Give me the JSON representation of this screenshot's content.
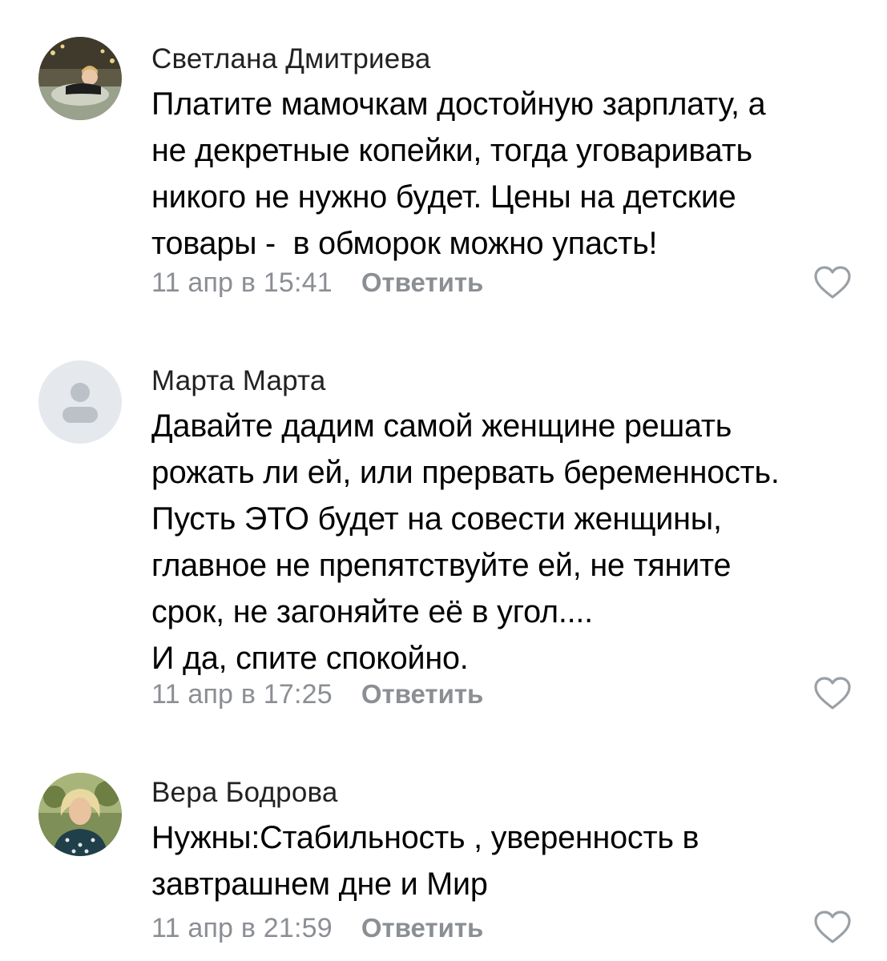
{
  "comments": [
    {
      "author": "Светлана Дмитриева",
      "avatar": "photo",
      "text_lines": [
        "Платите мамочкам достойную зарплату, а",
        "не декретные копейки, тогда уговаривать",
        "никого не нужно будет. Цены на детские",
        "товары -  в обморок можно упасть!"
      ],
      "date": "11 апр в 15:41",
      "reply_label": "Ответить",
      "like_icon": "heart-outline-icon"
    },
    {
      "author": "Марта Марта",
      "avatar": "default-user-placeholder",
      "text_lines": [
        "Давайте дадим самой женщине решать",
        "рожать ли ей, или прервать беременность.",
        "Пусть ЭТО будет на совести женщины,",
        "главное не препятствуйте ей, не тяните",
        "срок, не загоняйте её в угол....",
        "И да, спите спокойно."
      ],
      "date": "11 апр в 17:25",
      "reply_label": "Ответить",
      "like_icon": "heart-outline-icon"
    },
    {
      "author": "Вера Бодрова",
      "avatar": "photo",
      "text_lines": [
        "Нужны:Стабильность , уверенность в",
        "завтрашнем дне и Мир"
      ],
      "date": "11 апр в 21:59",
      "reply_label": "Ответить",
      "like_icon": "heart-outline-icon"
    }
  ],
  "colors": {
    "secondary_text": "#8b8f94",
    "author_text": "#222222",
    "placeholder_avatar_bg": "#e5e8ec",
    "placeholder_avatar_fg": "#bcc1c8"
  }
}
